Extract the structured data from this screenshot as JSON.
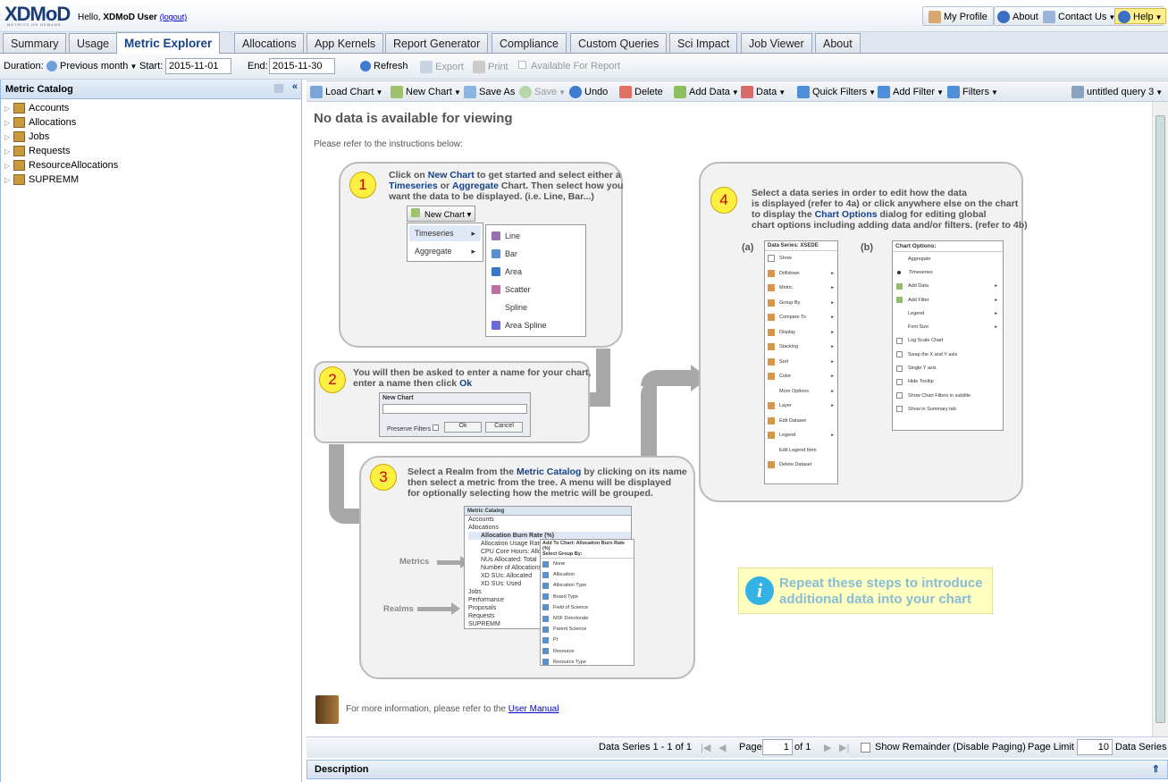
{
  "header": {
    "logo": "XDMoD",
    "logo_sub": "METRICS ON DEMAND",
    "hello": "Hello, ",
    "user": "XDMoD User",
    "logout": "(logout)",
    "my_profile": "My Profile",
    "about": "About",
    "contact_us": "Contact Us",
    "help": "Help"
  },
  "tabs": [
    "Summary",
    "Usage",
    "Metric Explorer",
    "Allocations",
    "App Kernels",
    "Report Generator",
    "Compliance",
    "Custom Queries",
    "Sci Impact",
    "Job Viewer",
    "About"
  ],
  "duration": {
    "label": "Duration:",
    "period": "Previous month",
    "start_label": "Start:",
    "start": "2015-11-01",
    "end_label": "End:",
    "end": "2015-11-30",
    "refresh": "Refresh",
    "export": "Export",
    "print": "Print",
    "available": "Available For Report"
  },
  "catalog": {
    "title": "Metric Catalog",
    "items": [
      "Accounts",
      "Allocations",
      "Jobs",
      "Requests",
      "ResourceAllocations",
      "SUPREMM"
    ]
  },
  "toolbar": {
    "load_chart": "Load Chart",
    "new_chart": "New Chart",
    "save_as": "Save As",
    "save": "Save",
    "undo": "Undo",
    "delete": "Delete",
    "add_data": "Add Data",
    "data": "Data",
    "quick_filters": "Quick Filters",
    "add_filter": "Add Filter",
    "filters": "Filters",
    "query": "untitled query 3"
  },
  "main": {
    "no_data": "No data is available for viewing",
    "refer": "Please refer to the instructions below:",
    "more_info": "For more information, please refer to the ",
    "user_manual": "User Manual",
    "repeat": "Repeat these steps to introduce additional data into your chart"
  },
  "step1": {
    "num": "1",
    "t1": "Click on ",
    "t1b": "New Chart",
    "t2": " to get started and select either a",
    "t3b": "Timeseries",
    "t3": " or ",
    "t4b": "Aggregate",
    "t4": " Chart. Then select how you",
    "t5": "want the data to be displayed. (i.e. Line, Bar...)",
    "btn": "New Chart",
    "menu": [
      "Timeseries",
      "Aggregate"
    ],
    "sub": [
      "Line",
      "Bar",
      "Area",
      "Scatter",
      "Spline",
      "Area Spline"
    ]
  },
  "step2": {
    "num": "2",
    "t1": "You will then be asked to enter a name for your chart,",
    "t2": "enter a name then click ",
    "t2b": "Ok",
    "dlg_title": "New Chart",
    "preserve": "Preserve Filters",
    "ok": "Ok",
    "cancel": "Cancel"
  },
  "step3": {
    "num": "3",
    "t1": "Select a Realm from the ",
    "t1b": "Metric Catalog",
    "t1c": " by clicking on its name",
    "t2": "then select a metric from the tree. A menu will be displayed",
    "t3": "for optionally selecting how the metric will be grouped.",
    "metrics": "Metrics",
    "realms": "Realms",
    "cat_title": "Metric Catalog",
    "tree": [
      "Accounts",
      "Allocations",
      "Allocation Burn Rate (%)",
      "Allocation Usage Rate (XD",
      "CPU Core Hours: Allocated",
      "NUs Allocated: Total",
      "Number of Allocations: Ac",
      "XD SUs: Allocated",
      "XD SUs: Used",
      "Jobs",
      "Performance",
      "Proposals",
      "Requests",
      "SUPREMM"
    ],
    "menu_title": "Add To Chart: Allocation Burn Rate (%)",
    "menu_sub": "Select Group By:",
    "groups": [
      "None",
      "Allocation",
      "Allocation Type",
      "Board Type",
      "Field of Science",
      "NSF Directorate",
      "Parent Science",
      "PI",
      "Resource",
      "Resource Type"
    ]
  },
  "step4": {
    "num": "4",
    "t1": "Select a data series in order to edit how the data",
    "t2": "is displayed (refer to 4a) or click anywhere else on the chart",
    "t3": "to display the ",
    "t3b": "Chart Options",
    "t3c": " dialog for editing global",
    "t4": "chart options including adding data and/or filters. (refer to 4b)",
    "a": "(a)",
    "b": "(b)",
    "ds_title": "Data Series: XSEDE",
    "ds_items": [
      "Show",
      "Drilldown",
      "Metric",
      "Group By",
      "Compare To",
      "Display",
      "Stacking",
      "Sort",
      "Color",
      "More Options",
      "Layer",
      "Edit Dataset",
      "Legend",
      "Edit Legend Item",
      "Delete Dataset"
    ],
    "co_title": "Chart Options:",
    "co_items": [
      "Aggregate",
      "Timeseries",
      "Add Data",
      "Add Filter",
      "Legend",
      "Font Size",
      "Log Scale Chart",
      "Swap the X and Y axis",
      "Single Y axis",
      "Hide Tooltip",
      "Show Chart Filters in subtitle",
      "Show in Summary tab"
    ]
  },
  "pager": {
    "series": "Data Series 1 - 1 of 1",
    "page": "Page",
    "page_val": "1",
    "of": "of 1",
    "remainder": "Show Remainder (Disable Paging)",
    "limit": "Page Limit",
    "limit_val": "10",
    "ds": "Data Series"
  },
  "description": "Description"
}
